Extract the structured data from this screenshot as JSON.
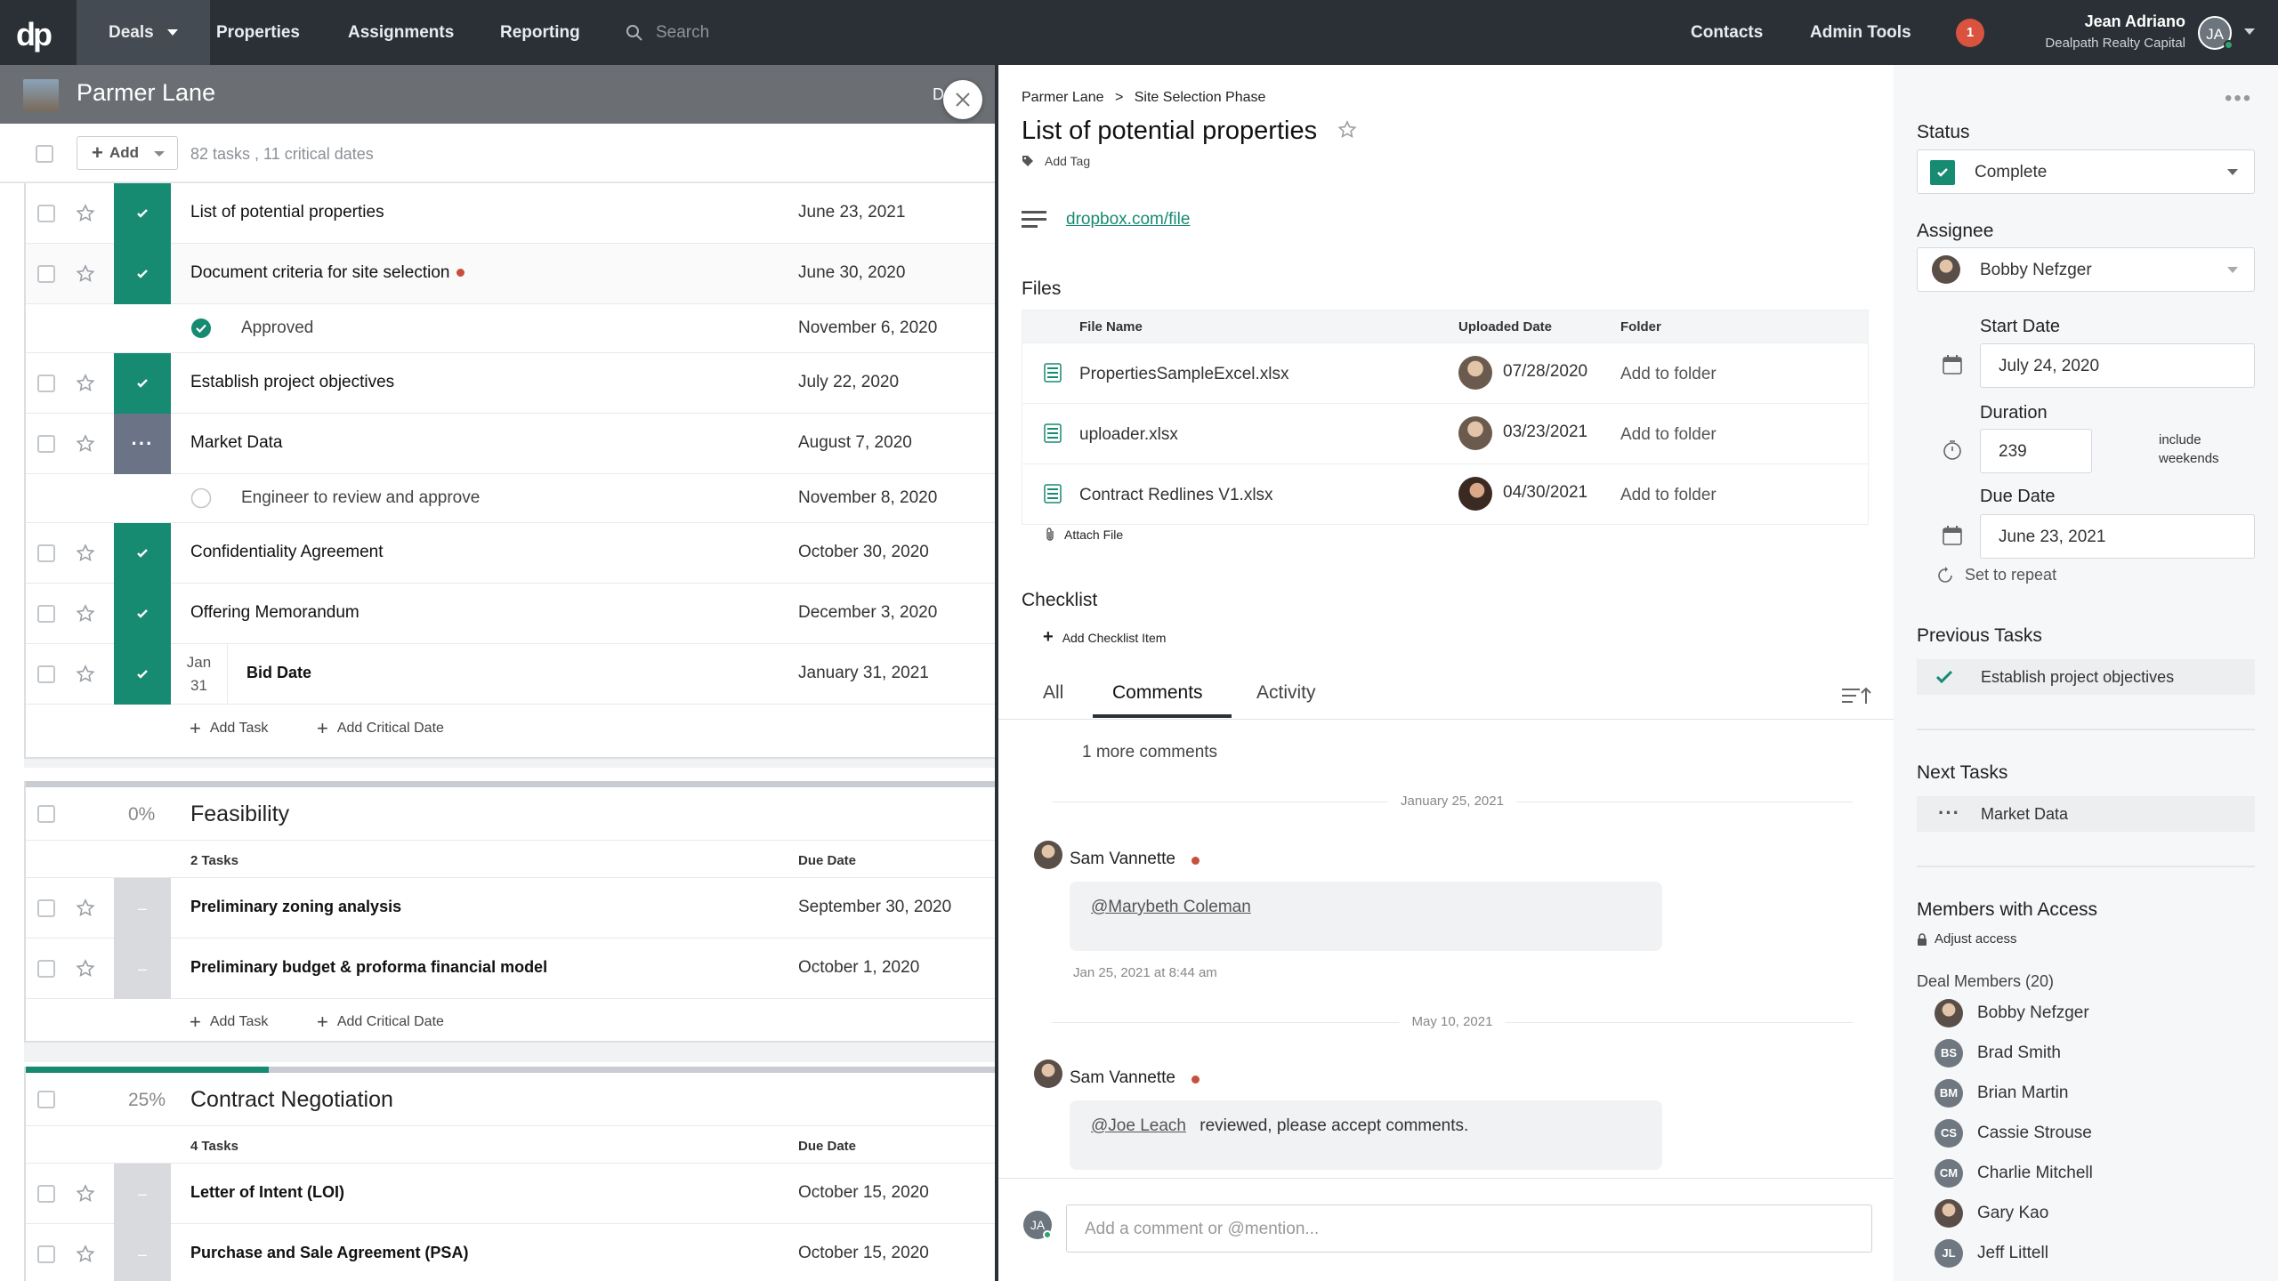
{
  "topnav": {
    "logo": "dp",
    "deals": "Deals",
    "properties": "Properties",
    "assignments": "Assignments",
    "reporting": "Reporting",
    "search_placeholder": "Search",
    "contacts": "Contacts",
    "admin_tools": "Admin Tools",
    "notifications": "1",
    "user_name": "Jean Adriano",
    "user_org": "Dealpath Realty Capital",
    "user_initials": "JA"
  },
  "deal": {
    "title": "Parmer Lane",
    "truncated": "D",
    "add_label": "Add",
    "summary": "82 tasks , 11 critical dates"
  },
  "tasks_section": {
    "rows": [
      {
        "name": "List of potential properties",
        "date": "June 23, 2021"
      },
      {
        "name": "Document criteria for site selection",
        "date": "June 30, 2020"
      },
      {
        "sub": "Approved",
        "date": "November 6, 2020"
      },
      {
        "name": "Establish project objectives",
        "date": "July 22, 2020"
      },
      {
        "name": "Market Data",
        "date": "August 7, 2020"
      },
      {
        "sub": "Engineer to review and approve",
        "date": "November 8, 2020"
      },
      {
        "name": "Confidentiality Agreement",
        "date": "October 30, 2020"
      },
      {
        "name": "Offering Memorandum",
        "date": "December 3, 2020"
      },
      {
        "name": "Bid Date",
        "date": "January 31, 2021",
        "month": "Jan",
        "day": "31"
      }
    ],
    "add_task": "Add Task",
    "add_critical_date": "Add Critical Date"
  },
  "feasibility": {
    "pct": "0%",
    "name": "Feasibility",
    "count": "2 Tasks",
    "due_header": "Due Date",
    "progress": 0,
    "rows": [
      {
        "name": "Preliminary zoning analysis",
        "date": "September 30, 2020"
      },
      {
        "name": "Preliminary budget & proforma financial model",
        "date": "October 1, 2020"
      }
    ],
    "add_task": "Add Task",
    "add_critical_date": "Add Critical Date"
  },
  "contract": {
    "pct": "25%",
    "name": "Contract Negotiation",
    "count": "4 Tasks",
    "due_header": "Due Date",
    "progress": 0.25,
    "rows": [
      {
        "name": "Letter of Intent (LOI)",
        "date": "October 15, 2020"
      },
      {
        "name": "Purchase and Sale Agreement (PSA)",
        "date": "October 15, 2020"
      }
    ]
  },
  "detail": {
    "crumb_deal": "Parmer Lane",
    "crumb_sep": ">",
    "crumb_phase": "Site Selection Phase",
    "title": "List of potential properties",
    "add_tag": "Add Tag",
    "link": "dropbox.com/file",
    "files_heading": "Files",
    "files_cols": {
      "name": "File Name",
      "date": "Uploaded Date",
      "folder": "Folder"
    },
    "files": [
      {
        "name": "PropertiesSampleExcel.xlsx",
        "date": "07/28/2020",
        "folder": "Add to folder"
      },
      {
        "name": "uploader.xlsx",
        "date": "03/23/2021",
        "folder": "Add to folder"
      },
      {
        "name": "Contract Redlines V1.xlsx",
        "date": "04/30/2021",
        "folder": "Add to folder"
      }
    ],
    "attach_file": "Attach File",
    "checklist_heading": "Checklist",
    "add_checklist_item": "Add Checklist Item",
    "tabs": [
      "All",
      "Comments",
      "Activity"
    ],
    "more_comments": "1 more comments",
    "comments": [
      {
        "date_sep": "January 25, 2021",
        "author": "Sam Vannette",
        "mention": "@Marybeth Coleman",
        "text": "",
        "time": "Jan 25, 2021 at 8:44 am"
      },
      {
        "date_sep": "May 10, 2021",
        "author": "Sam Vannette",
        "mention": "@Joe Leach",
        "text": "reviewed, please accept comments.",
        "time": ""
      }
    ],
    "comment_placeholder": "Add a comment or @mention...",
    "me_initials": "JA"
  },
  "sidebar": {
    "status_label": "Status",
    "status_value": "Complete",
    "assignee_label": "Assignee",
    "assignee_value": "Bobby Nefzger",
    "start_label": "Start Date",
    "start_value": "July 24, 2020",
    "duration_label": "Duration",
    "duration_value": "239",
    "include_weekends_1": "include",
    "include_weekends_2": "weekends",
    "due_label": "Due Date",
    "due_value": "June 23, 2021",
    "repeat": "Set to repeat",
    "prev_label": "Previous Tasks",
    "prev_task": "Establish project objectives",
    "next_label": "Next Tasks",
    "next_task": "Market Data",
    "members_label": "Members with Access",
    "adjust_access": "Adjust access",
    "deal_members": "Deal Members (20)",
    "members": [
      {
        "name": "Bobby Nefzger",
        "initials": ""
      },
      {
        "name": "Brad Smith",
        "initials": "BS"
      },
      {
        "name": "Brian Martin",
        "initials": "BM"
      },
      {
        "name": "Cassie Strouse",
        "initials": "CS"
      },
      {
        "name": "Charlie Mitchell",
        "initials": "CM"
      },
      {
        "name": "Gary Kao",
        "initials": ""
      },
      {
        "name": "Jeff Littell",
        "initials": "JL"
      }
    ]
  }
}
